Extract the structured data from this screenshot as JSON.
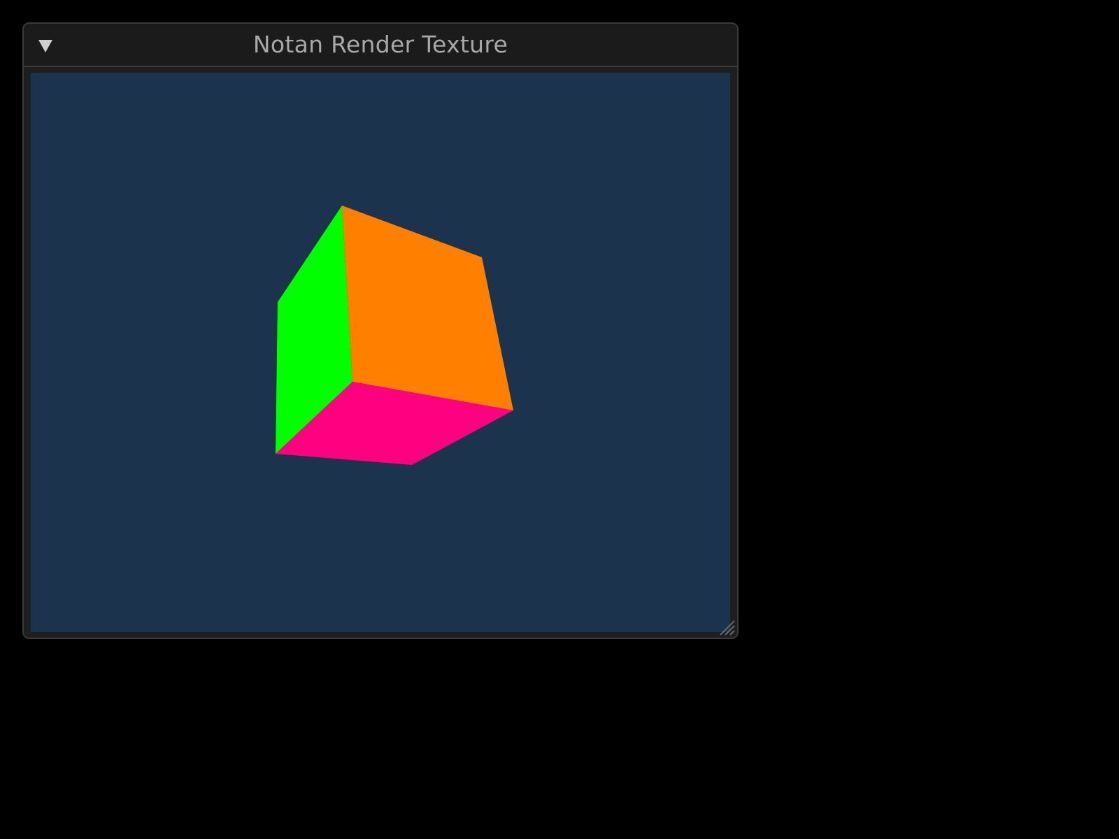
{
  "window": {
    "title": "Notan Render Texture",
    "collapse_icon": "triangle-down-icon",
    "resize_icon": "resize-grip-icon"
  },
  "render_texture": {
    "background_color": "#1b334c",
    "object": "cube",
    "faces": [
      {
        "name": "left-face",
        "color": "#00ff00"
      },
      {
        "name": "front-face",
        "color": "#ff8000"
      },
      {
        "name": "bottom-face",
        "color": "#ff0080"
      }
    ]
  },
  "colors": {
    "window_bg": "#1e1e1e",
    "titlebar_bg": "#1b1b1b",
    "title_text": "#a8a8a8",
    "border": "#3a3a3a"
  }
}
